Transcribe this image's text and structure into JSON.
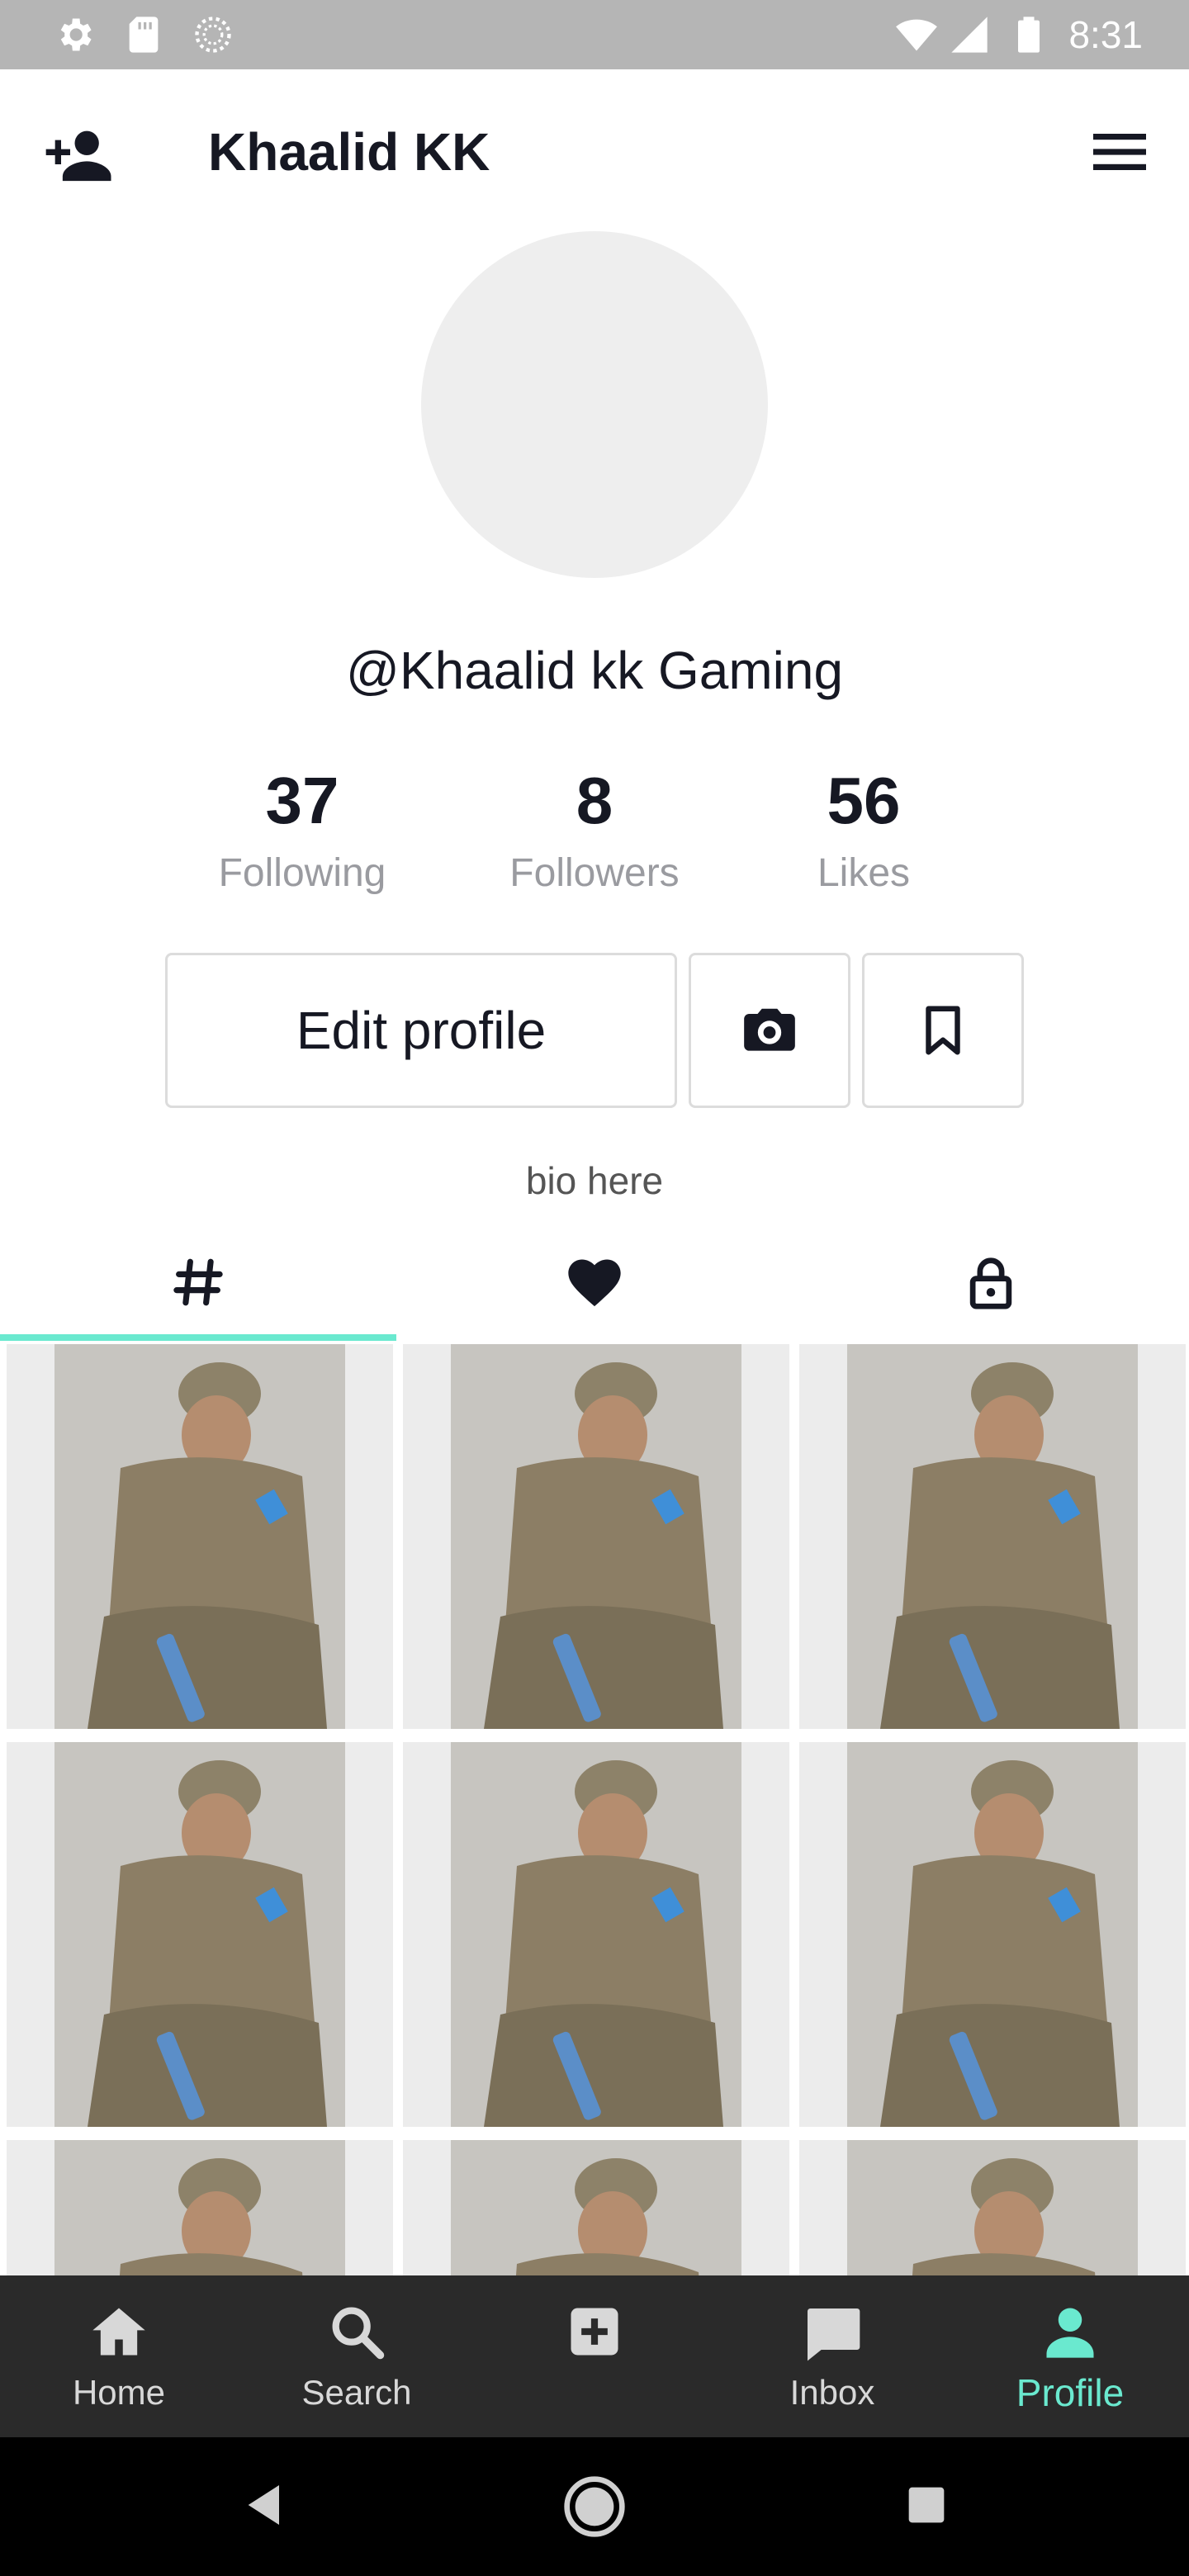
{
  "status_bar": {
    "time": "8:31",
    "icons": [
      "settings-icon",
      "sd-card-icon",
      "loading-icon",
      "wifi-icon",
      "signal-icon",
      "battery-icon"
    ]
  },
  "header": {
    "title": "Khaalid KK",
    "add_user_icon": "add-user-icon",
    "menu_icon": "hamburger-menu-icon"
  },
  "profile": {
    "username": "@Khaalid kk Gaming",
    "stats": [
      {
        "value": "37",
        "label": "Following"
      },
      {
        "value": "8",
        "label": "Followers"
      },
      {
        "value": "56",
        "label": "Likes"
      }
    ],
    "edit_button": "Edit profile",
    "camera_icon": "camera-icon",
    "bookmark_icon": "bookmark-icon",
    "bio": "bio here"
  },
  "tabs": [
    {
      "icon": "hashtag-icon",
      "active": true
    },
    {
      "icon": "heart-icon",
      "active": false
    },
    {
      "icon": "lock-icon",
      "active": false
    }
  ],
  "grid": {
    "visible_thumbnails": 9,
    "complete_rows": 2
  },
  "bottom_nav": [
    {
      "label": "Home",
      "icon": "home-icon",
      "active": false
    },
    {
      "label": "Search",
      "icon": "search-icon",
      "active": false
    },
    {
      "label": "",
      "icon": "add-post-icon",
      "active": false
    },
    {
      "label": "Inbox",
      "icon": "inbox-icon",
      "active": false
    },
    {
      "label": "Profile",
      "icon": "profile-icon",
      "active": true
    }
  ],
  "colors": {
    "accent": "#6ae9cf",
    "status_bar": "#b5b5b5",
    "nav_background": "#2a2a2a",
    "text": "#161823",
    "muted_text": "#9a9ba0",
    "avatar_placeholder": "#eeeeee"
  }
}
